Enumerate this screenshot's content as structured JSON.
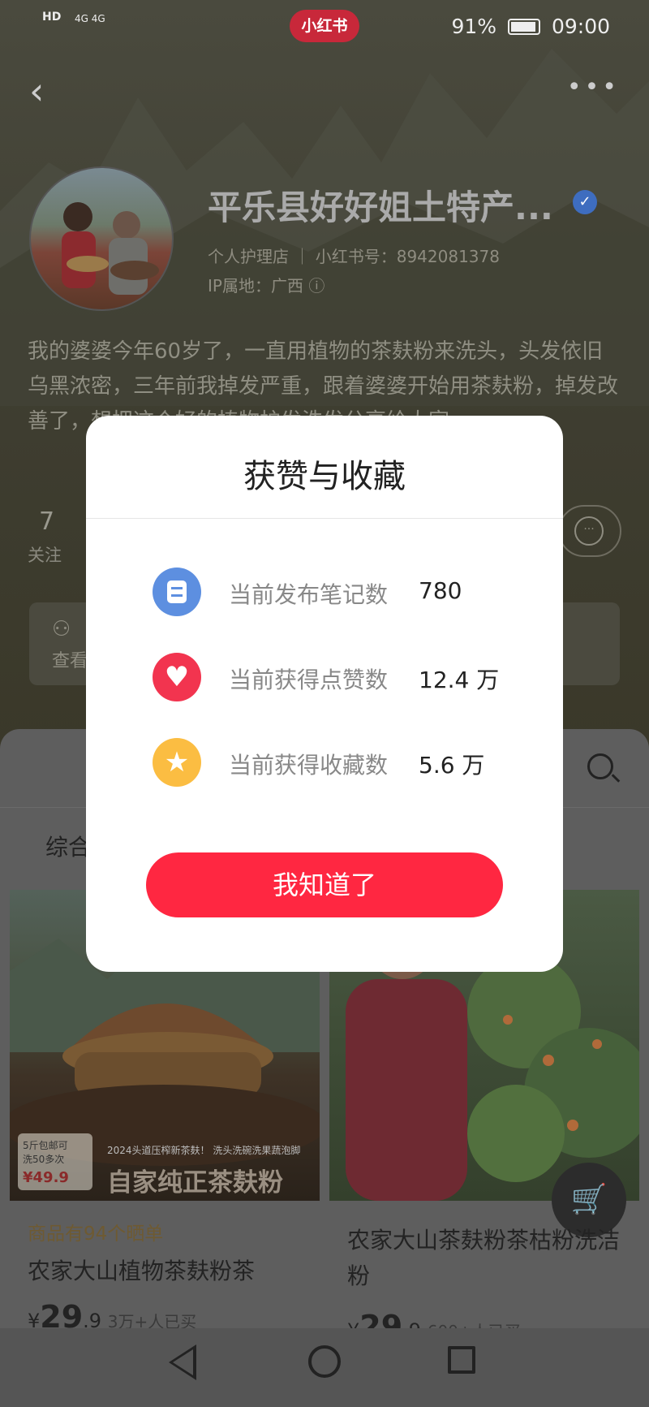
{
  "status_bar": {
    "left_label": "HD",
    "network": "4G 4G",
    "app_badge": "小红书",
    "battery": "91%",
    "time": "09:00"
  },
  "header": {
    "back_icon": "chevron-left-icon",
    "more_icon": "more-icon",
    "more_glyph": "•••"
  },
  "profile": {
    "name": "平乐县好好姐土特产...",
    "category": "个人护理店",
    "xhs_id": "小红书号：8942081378",
    "ip": "IP属地：广西",
    "bio": "我的婆婆今年60岁了，一直用植物的茶麸粉来洗头，头发依旧乌黑浓密，三年前我掉发严重，跟着婆婆开始用茶麸粉，掉发改善了，想把这个好的植物护发洗发分享给大家",
    "following_count": "7",
    "following_label": "关注",
    "info_card_text": "查看"
  },
  "content_panel": {
    "tab_label": "综合",
    "search_icon": "search-icon"
  },
  "products": [
    {
      "sticker_line1": "5斤包邮可",
      "sticker_line2": "洗50多次",
      "sticker_price": "¥49.9",
      "caption_small": "2024头道压榨新茶麸！ 洗头洗碗洗果蔬泡脚",
      "caption_big": "自家纯正茶麸粉",
      "sub": "商品有94个晒单",
      "name": "农家大山植物茶麸粉茶",
      "currency": "¥",
      "price_int": "29",
      "price_dec": ".9",
      "sold": "3万+人已买"
    },
    {
      "name": "农家大山茶麸粉茶枯粉洗洁粉",
      "currency": "¥",
      "price_int": "29",
      "price_dec": ".9",
      "sold": "600+人已买"
    }
  ],
  "dialog": {
    "title": "获赞与收藏",
    "rows": [
      {
        "icon": "notes-icon",
        "label": "当前发布笔记数",
        "value": "780",
        "color": "#5d8fe0"
      },
      {
        "icon": "heart-icon",
        "label": "当前获得点赞数",
        "value": "12.4 万",
        "color": "#f2344f"
      },
      {
        "icon": "star-icon",
        "label": "当前获得收藏数",
        "value": "5.6 万",
        "color": "#fbbd42"
      }
    ],
    "button": "我知道了",
    "button_color": "#ff2741"
  },
  "nav_bar": {
    "back": "nav-back-icon",
    "home": "nav-home-icon",
    "recent": "nav-recent-icon"
  }
}
